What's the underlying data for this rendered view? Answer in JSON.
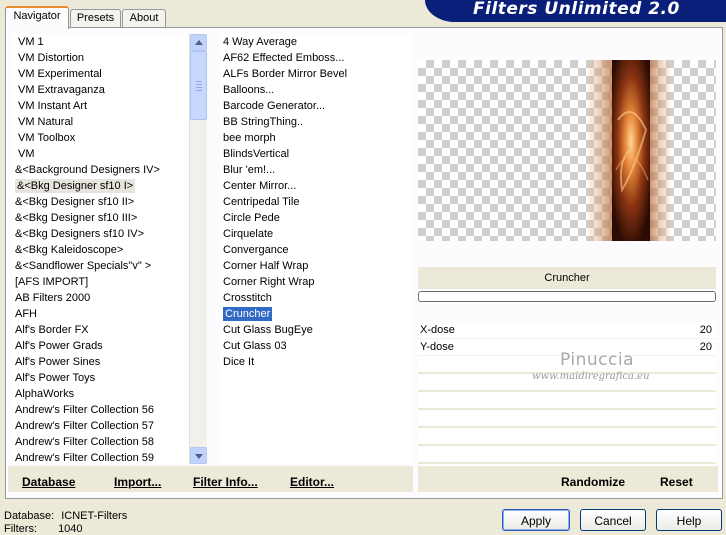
{
  "tabs": [
    {
      "label": "Navigator",
      "active": true
    },
    {
      "label": "Presets",
      "active": false
    },
    {
      "label": "About",
      "active": false
    }
  ],
  "banner": {
    "title": "Filters Unlimited 2.0"
  },
  "categories": [
    "VM 1",
    "VM Distortion",
    "VM Experimental",
    "VM Extravaganza",
    "VM Instant Art",
    "VM Natural",
    "VM Toolbox",
    "VM",
    "&<Background Designers IV>",
    "&<Bkg Designer sf10 I>",
    "&<Bkg Designer sf10 II>",
    "&<Bkg Designer sf10 III>",
    "&<Bkg Designers sf10 IV>",
    "&<Bkg Kaleidoscope>",
    "&<Sandflower Specials\"v\" >",
    "[AFS IMPORT]",
    "AB Filters 2000",
    "AFH",
    "Alf's Border FX",
    "Alf's Power Grads",
    "Alf's Power Sines",
    "Alf's Power Toys",
    "AlphaWorks",
    "Andrew's Filter Collection 56",
    "Andrew's Filter Collection 57",
    "Andrew's Filter Collection 58",
    "Andrew's Filter Collection 59"
  ],
  "selected_category_index": 9,
  "filters": [
    "4 Way Average",
    "AF62 Effected Emboss...",
    "ALFs Border Mirror Bevel",
    "Balloons...",
    "Barcode Generator...",
    "BB StringThing..",
    "bee morph",
    "BlindsVertical",
    "Blur 'em!...",
    "Center Mirror...",
    "Centripedal Tile",
    "Circle Pede",
    "Cirquelate",
    "Convergance",
    "Corner Half Wrap",
    "Corner Right Wrap",
    "Crosstitch",
    "Cruncher",
    "Cut Glass  BugEye",
    "Cut Glass 03",
    "Dice It"
  ],
  "selected_filter_index": 17,
  "left_buttons": {
    "database": "Database",
    "import": "Import...",
    "filter_info": "Filter Info...",
    "editor": "Editor..."
  },
  "selected_filter_name": "Cruncher",
  "progress": 0,
  "params": [
    {
      "label": "X-dose",
      "value": "20"
    },
    {
      "label": "Y-dose",
      "value": "20"
    }
  ],
  "watermark": {
    "name": "Pinuccia",
    "site": "www.maidiregrafica.eu"
  },
  "right_buttons": {
    "randomize": "Randomize",
    "reset": "Reset"
  },
  "status": {
    "database_label": "Database:",
    "database_value": "ICNET-Filters",
    "filters_label": "Filters:",
    "filters_value": "1040"
  },
  "dialog_buttons": {
    "apply": "Apply",
    "cancel": "Cancel",
    "help": "Help"
  }
}
